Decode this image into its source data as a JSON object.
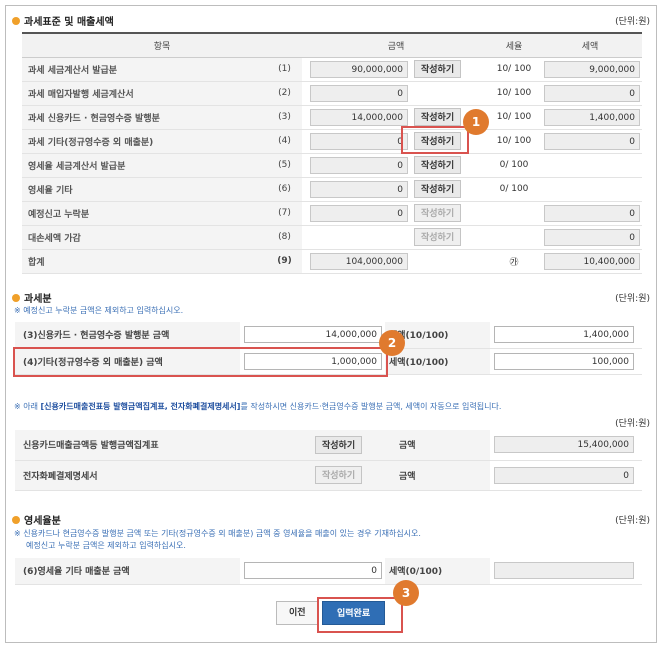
{
  "section1": {
    "title": "과세표준 및 매출세액",
    "unit": "(단위:원)",
    "headers": [
      "항목",
      "금액",
      "세율",
      "세액"
    ],
    "rows": [
      {
        "label": "과세 세금계산서 발급분",
        "no": "(1)",
        "amount": "90,000,000",
        "button": "작성하기",
        "rate": "10/ 100",
        "tax": "9,000,000"
      },
      {
        "label": "과세 매입자발행 세금계산서",
        "no": "(2)",
        "amount": "0",
        "button": "",
        "rate": "10/ 100",
        "tax": "0"
      },
      {
        "label": "과세 신용카드 · 현금영수증 발행분",
        "no": "(3)",
        "amount": "14,000,000",
        "button": "작성하기",
        "rate": "10/ 100",
        "tax": "1,400,000"
      },
      {
        "label": "과세 기타(정규영수증 외 매출분)",
        "no": "(4)",
        "amount": "0",
        "button": "작성하기",
        "rate": "10/ 100",
        "tax": "0"
      },
      {
        "label": "영세율 세금계산서 발급분",
        "no": "(5)",
        "amount": "0",
        "button": "작성하기",
        "rate": "0/ 100",
        "tax": ""
      },
      {
        "label": "영세율 기타",
        "no": "(6)",
        "amount": "0",
        "button": "작성하기",
        "rate": "0/ 100",
        "tax": ""
      },
      {
        "label": "예정신고 누락분",
        "no": "(7)",
        "amount": "0",
        "button": "작성하기",
        "rate": "",
        "tax": "0"
      },
      {
        "label": "대손세액 가감",
        "no": "(8)",
        "amount": "",
        "button": "작성하기",
        "rate": "",
        "tax": "0"
      },
      {
        "label": "합계",
        "no": "(9)",
        "amount": "104,000,000",
        "button": "",
        "rate": "㉮",
        "tax": "10,400,000"
      }
    ]
  },
  "section2": {
    "title": "과세분",
    "unit": "(단위:원)",
    "note": "※ 예정신고 누락분 금액은 제외하고 입력하십시오.",
    "rows": [
      {
        "label": "(3)신용카드 · 현금영수증 발행분 금액",
        "amount": "14,000,000",
        "tax_label": "세액(10/100)",
        "tax": "1,400,000"
      },
      {
        "label": "(4)기타(정규영수증 외 매출분) 금액",
        "amount": "1,000,000",
        "tax_label": "세액(10/100)",
        "tax": "100,000"
      }
    ]
  },
  "section3": {
    "note_prefix": "※ 아래 ",
    "note_highlight": "[신용카드매출전표등 발행금액집계표, 전자화폐결제명세서]",
    "note_suffix": "를 작성하시면 신용카드·현금영수증 발행분 금액, 세액이 자동으로 입력됩니다.",
    "unit": "(단위:원)",
    "rows": [
      {
        "label": "신용카드매출금액등 발행금액집계표",
        "button": "작성하기",
        "amount_label": "금액",
        "amount": "15,400,000"
      },
      {
        "label": "전자화폐결제명세서",
        "button": "작성하기",
        "amount_label": "금액",
        "amount": "0"
      }
    ]
  },
  "section4": {
    "title": "영세율분",
    "unit": "(단위:원)",
    "note1": "※ 신용카드나 현금영수증 발행분 금액 또는 기타(정규영수증 외 매출분) 금액 중 영세율을 매출이 있는 경우 기재하십시오.",
    "note2": "예정신고 누락분 금액은 제외하고 입력하십시오.",
    "row": {
      "label": "(6)영세율 기타 매출분 금액",
      "amount": "0",
      "tax_label": "세액(0/100)",
      "tax": ""
    }
  },
  "footer": {
    "prev_label": "이전",
    "submit_label": "입력완료"
  },
  "callouts": [
    "1",
    "2",
    "3"
  ],
  "colors": {
    "accent": "#e07a2e",
    "highlight": "#d9534f",
    "primary_button": "#2f6eb5",
    "note": "#3a6fb5"
  }
}
